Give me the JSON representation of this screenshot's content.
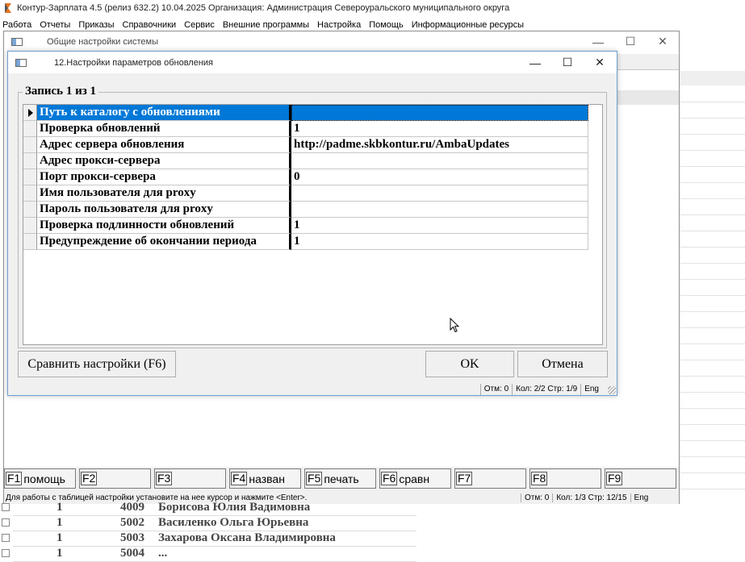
{
  "app": {
    "title": "Контур-Зарплата 4.5 (релиз 632.2) 10.04.2025  Организация: Администрация Североуральского муниципального округа",
    "menu": [
      "Работа",
      "Отчеты",
      "Приказы",
      "Справочники",
      "Сервис",
      "Внешние программы",
      "Настройка",
      "Помощь",
      "Информационные ресурсы"
    ]
  },
  "bg_window": {
    "title": "Общие настройки системы",
    "fkeys": [
      {
        "key": "F1",
        "label": "помощь"
      },
      {
        "key": "F2",
        "label": ""
      },
      {
        "key": "F3",
        "label": ""
      },
      {
        "key": "F4",
        "label": "назван"
      },
      {
        "key": "F5",
        "label": "печать"
      },
      {
        "key": "F6",
        "label": "сравн"
      },
      {
        "key": "F7",
        "label": ""
      },
      {
        "key": "F8",
        "label": ""
      },
      {
        "key": "F9",
        "label": ""
      }
    ],
    "status": {
      "hint": "Для работы с таблицей настройки установите на нее курсор и нажмите <Enter>.",
      "otm": "Отм: 0",
      "kol": "Кол: 1/3  Стр: 12/15",
      "lang": "Eng"
    }
  },
  "bottom_rows": [
    {
      "num": "1",
      "code": "4009",
      "name": "Борисова Юлия Вадимовна"
    },
    {
      "num": "1",
      "code": "5002",
      "name": "Василенко Ольга Юрьевна"
    },
    {
      "num": "1",
      "code": "5003",
      "name": "Захарова Оксана Владимировна"
    },
    {
      "num": "1",
      "code": "5004",
      "name": "..."
    }
  ],
  "dialog": {
    "title": "12.Настройки параметров обновления",
    "record_label": "Запись 1 из 1",
    "rows": [
      {
        "name": "Путь к каталогу с обновлениями",
        "value": ""
      },
      {
        "name": "Проверка обновлений",
        "value": "1"
      },
      {
        "name": "Адрес сервера обновления",
        "value": "http://padme.skbkontur.ru/AmbaUpdates"
      },
      {
        "name": "Адрес прокси-сервера",
        "value": ""
      },
      {
        "name": "Порт прокси-сервера",
        "value": "0"
      },
      {
        "name": "Имя пользователя для proxy",
        "value": ""
      },
      {
        "name": "Пароль пользователя для proxy",
        "value": ""
      },
      {
        "name": "Проверка подлинности обновлений",
        "value": "1"
      },
      {
        "name": "Предупреждение об окончании периода",
        "value": "1"
      }
    ],
    "buttons": {
      "compare": "Сравнить настройки (F6)",
      "ok": "OK",
      "cancel": "Отмена"
    },
    "status": {
      "otm": "Отм: 0",
      "kol": "Кол: 2/2  Стр: 1/9",
      "lang": "Eng"
    }
  },
  "colors": {
    "selection": "#0078d7",
    "window_bg": "#f0f0f0",
    "dialog_border": "#6e9fd0"
  }
}
